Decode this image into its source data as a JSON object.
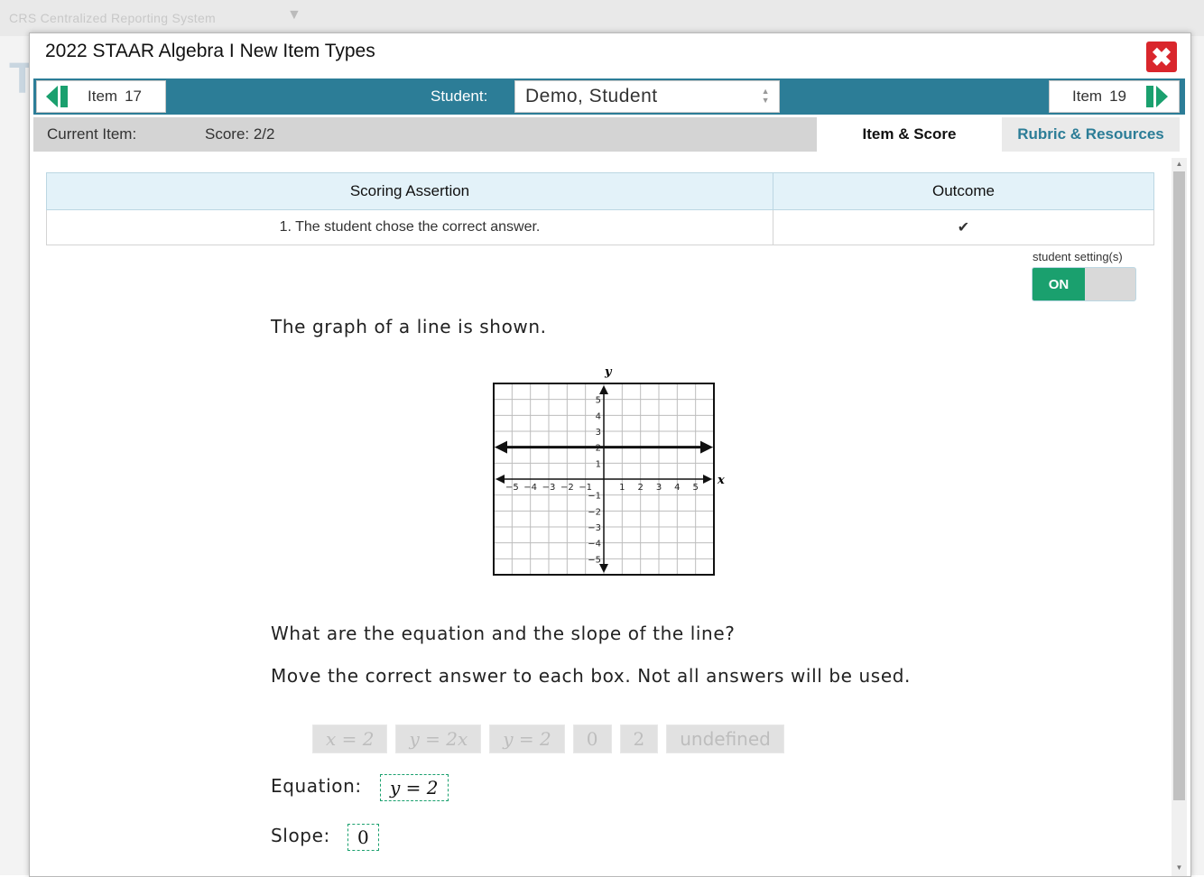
{
  "background": {
    "app_title": "CRS   Centralized Reporting System",
    "ghost_letter": "T"
  },
  "modal": {
    "title": "2022 STAAR Algebra I New Item Types",
    "close_glyph": "✖"
  },
  "nav": {
    "prev_label": "Item",
    "prev_number": "17",
    "next_label": "Item",
    "next_number": "19",
    "student_label": "Student:",
    "student_value": "Demo, Student"
  },
  "info": {
    "current_item": "Current Item:",
    "score": "Score: 2/2"
  },
  "tabs": {
    "item_score": "Item & Score",
    "rubric": "Rubric & Resources"
  },
  "scoring_table": {
    "headers": [
      "Scoring Assertion",
      "Outcome"
    ],
    "rows": [
      {
        "assertion": "1. The student chose the correct answer.",
        "outcome": "✔"
      }
    ]
  },
  "student_setting": {
    "label": "student setting(s)",
    "state": "ON"
  },
  "question": {
    "intro": "The graph of a line is shown.",
    "prompt": "What are the equation and the slope of the line?",
    "instruction": "Move the correct answer to each box. Not all answers will be used.",
    "answer_tiles": [
      "x = 2",
      "y = 2x",
      "y = 2",
      "0",
      "2",
      "undefined"
    ],
    "equation_label": "Equation:",
    "equation_answer": "y = 2",
    "slope_label": "Slope:",
    "slope_answer": "0"
  },
  "graph": {
    "x_axis_label": "x",
    "y_axis_label": "y",
    "x_ticks": [
      "−5",
      "−4",
      "−3",
      "−2",
      "−1",
      "1",
      "2",
      "3",
      "4",
      "5"
    ],
    "y_ticks": [
      "5",
      "4",
      "3",
      "2",
      "1",
      "−1",
      "−2",
      "−3",
      "−4",
      "−5"
    ],
    "range": [
      -6,
      6
    ],
    "line": {
      "equation": "y = 2",
      "y": 2
    }
  },
  "colors": {
    "nav_bar": "#2c7d97",
    "close": "#d9262c",
    "toggle_on": "#1aa06e"
  }
}
